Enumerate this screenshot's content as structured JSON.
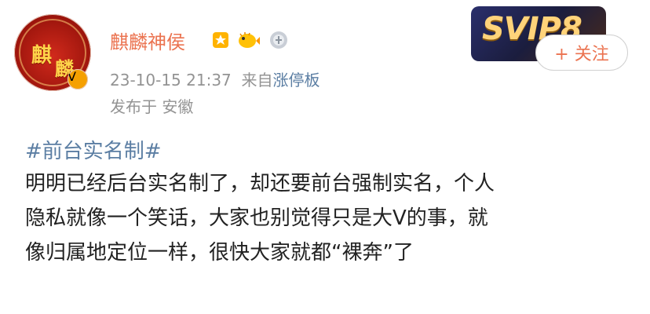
{
  "post": {
    "author": "麒麟神侯",
    "time": "23-10-15 21:37",
    "source_prefix": "来自",
    "source_name": "涨停板",
    "location": "发布于 安徽",
    "follow_label": "+ 关注",
    "svip_label": "SVIP8",
    "avatar_text_1": "麒",
    "avatar_text_2": "麟",
    "avatar_badge": "V",
    "hashtag": "#前台实名制#",
    "body_lines": [
      "明明已经后台实名制了，却还要前台强制实名，个人",
      "隐私就像一个笑话，大家也别觉得只是大V的事，就",
      "像归属地定位一样，很快大家就都“裸奔”了"
    ]
  },
  "colors": {
    "author": "#eb7350",
    "link": "#5b7ea3",
    "meta": "#939393",
    "text": "#222222"
  },
  "icons": [
    "verified-badge-icon",
    "medal-icon",
    "pufferfish-icon",
    "silver-medal-icon"
  ]
}
